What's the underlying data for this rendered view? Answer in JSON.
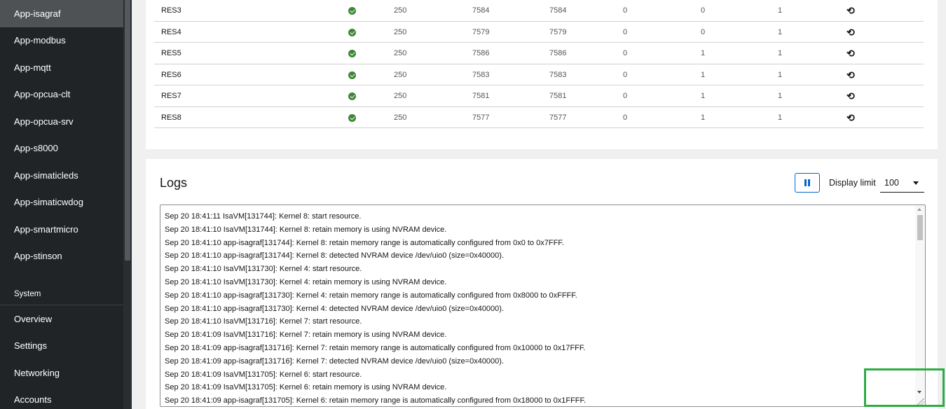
{
  "sidebar": {
    "apps": [
      {
        "label": "App-isagraf",
        "active": true
      },
      {
        "label": "App-modbus"
      },
      {
        "label": "App-mqtt"
      },
      {
        "label": "App-opcua-clt"
      },
      {
        "label": "App-opcua-srv"
      },
      {
        "label": "App-s8000"
      },
      {
        "label": "App-simaticleds"
      },
      {
        "label": "App-simaticwdog"
      },
      {
        "label": "App-smartmicro"
      },
      {
        "label": "App-stinson"
      }
    ],
    "section_title": "System",
    "system_items": [
      {
        "label": "Overview"
      },
      {
        "label": "Settings"
      },
      {
        "label": "Networking"
      },
      {
        "label": "Accounts"
      }
    ]
  },
  "resources": {
    "rows": [
      {
        "name": "RES3",
        "status": "ok",
        "c2": "250",
        "c3": "7584",
        "c4": "7584",
        "c5": "0",
        "c6": "0",
        "c7": "1"
      },
      {
        "name": "RES4",
        "status": "ok",
        "c2": "250",
        "c3": "7579",
        "c4": "7579",
        "c5": "0",
        "c6": "0",
        "c7": "1"
      },
      {
        "name": "RES5",
        "status": "ok",
        "c2": "250",
        "c3": "7586",
        "c4": "7586",
        "c5": "0",
        "c6": "1",
        "c7": "1"
      },
      {
        "name": "RES6",
        "status": "ok",
        "c2": "250",
        "c3": "7583",
        "c4": "7583",
        "c5": "0",
        "c6": "1",
        "c7": "1"
      },
      {
        "name": "RES7",
        "status": "ok",
        "c2": "250",
        "c3": "7581",
        "c4": "7581",
        "c5": "0",
        "c6": "1",
        "c7": "1"
      },
      {
        "name": "RES8",
        "status": "ok",
        "c2": "250",
        "c3": "7577",
        "c4": "7577",
        "c5": "0",
        "c6": "1",
        "c7": "1"
      }
    ],
    "status_icon": "check-circle-icon",
    "action_icon": "undo-icon",
    "undo_glyph": "⟲"
  },
  "logs": {
    "title": "Logs",
    "pause_icon": "pause-icon",
    "display_limit_label": "Display limit",
    "display_limit_value": "100",
    "lines": [
      "Sep 20 18:41:11 IsaVM[131744]: Kernel 8: start resource.",
      "Sep 20 18:41:10 IsaVM[131744]: Kernel 8: retain memory is using NVRAM device.",
      "Sep 20 18:41:10 app-isagraf[131744]: Kernel 8: retain memory range is automatically configured from 0x0 to 0x7FFF.",
      "Sep 20 18:41:10 app-isagraf[131744]: Kernel 8: detected NVRAM device /dev/uio0 (size=0x40000).",
      "Sep 20 18:41:10 IsaVM[131730]: Kernel 4: start resource.",
      "Sep 20 18:41:10 IsaVM[131730]: Kernel 4: retain memory is using NVRAM device.",
      "Sep 20 18:41:10 app-isagraf[131730]: Kernel 4: retain memory range is automatically configured from 0x8000 to 0xFFFF.",
      "Sep 20 18:41:10 app-isagraf[131730]: Kernel 4: detected NVRAM device /dev/uio0 (size=0x40000).",
      "Sep 20 18:41:10 IsaVM[131716]: Kernel 7: start resource.",
      "Sep 20 18:41:09 IsaVM[131716]: Kernel 7: retain memory is using NVRAM device.",
      "Sep 20 18:41:09 app-isagraf[131716]: Kernel 7: retain memory range is automatically configured from 0x10000 to 0x17FFF.",
      "Sep 20 18:41:09 app-isagraf[131716]: Kernel 7: detected NVRAM device /dev/uio0 (size=0x40000).",
      "Sep 20 18:41:09 IsaVM[131705]: Kernel 6: start resource.",
      "Sep 20 18:41:09 IsaVM[131705]: Kernel 6: retain memory is using NVRAM device.",
      "Sep 20 18:41:09 app-isagraf[131705]: Kernel 6: retain memory range is automatically configured from 0x18000 to 0x1FFFF."
    ]
  },
  "colors": {
    "sidebar_bg": "#212427",
    "active_item": "#4f5255",
    "ok_green": "#3e8635",
    "primary_blue": "#0066cc",
    "highlight_green": "#2fab43"
  }
}
